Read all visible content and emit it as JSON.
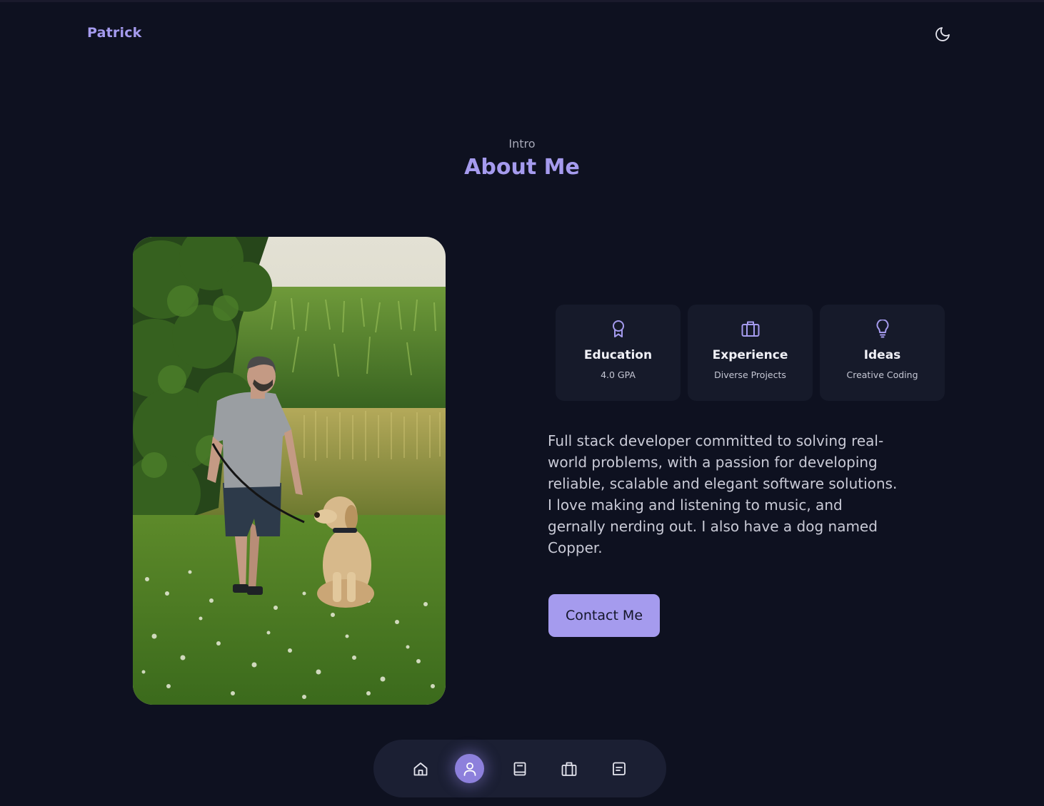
{
  "header": {
    "brand": "Patrick",
    "theme_toggle_icon": "moon-icon"
  },
  "about": {
    "subtitle": "Intro",
    "title": "About Me",
    "photo_alt": "Man walking a golden retriever on a leash through a grassy field",
    "cards": [
      {
        "icon": "award-icon",
        "title": "Education",
        "sub": "4.0 GPA"
      },
      {
        "icon": "briefcase-icon",
        "title": "Experience",
        "sub": "Diverse Projects"
      },
      {
        "icon": "lightbulb-icon",
        "title": "Ideas",
        "sub": "Creative Coding"
      }
    ],
    "description": "Full stack developer committed to solving real-world problems, with a passion for developing reliable, scalable and elegant software solutions. I love making and listening to music, and gernally nerding out. I also have a dog named Copper.",
    "contact_label": "Contact Me"
  },
  "nav": {
    "items": [
      {
        "icon": "home-icon",
        "active": false
      },
      {
        "icon": "user-icon",
        "active": true
      },
      {
        "icon": "book-icon",
        "active": false
      },
      {
        "icon": "briefcase-icon",
        "active": false
      },
      {
        "icon": "message-icon",
        "active": false
      }
    ]
  },
  "colors": {
    "background": "#0e1120",
    "accent": "#a59bee",
    "card": "#161a2a",
    "nav_bg": "#1b1f33",
    "nav_active": "#8d80dc"
  }
}
